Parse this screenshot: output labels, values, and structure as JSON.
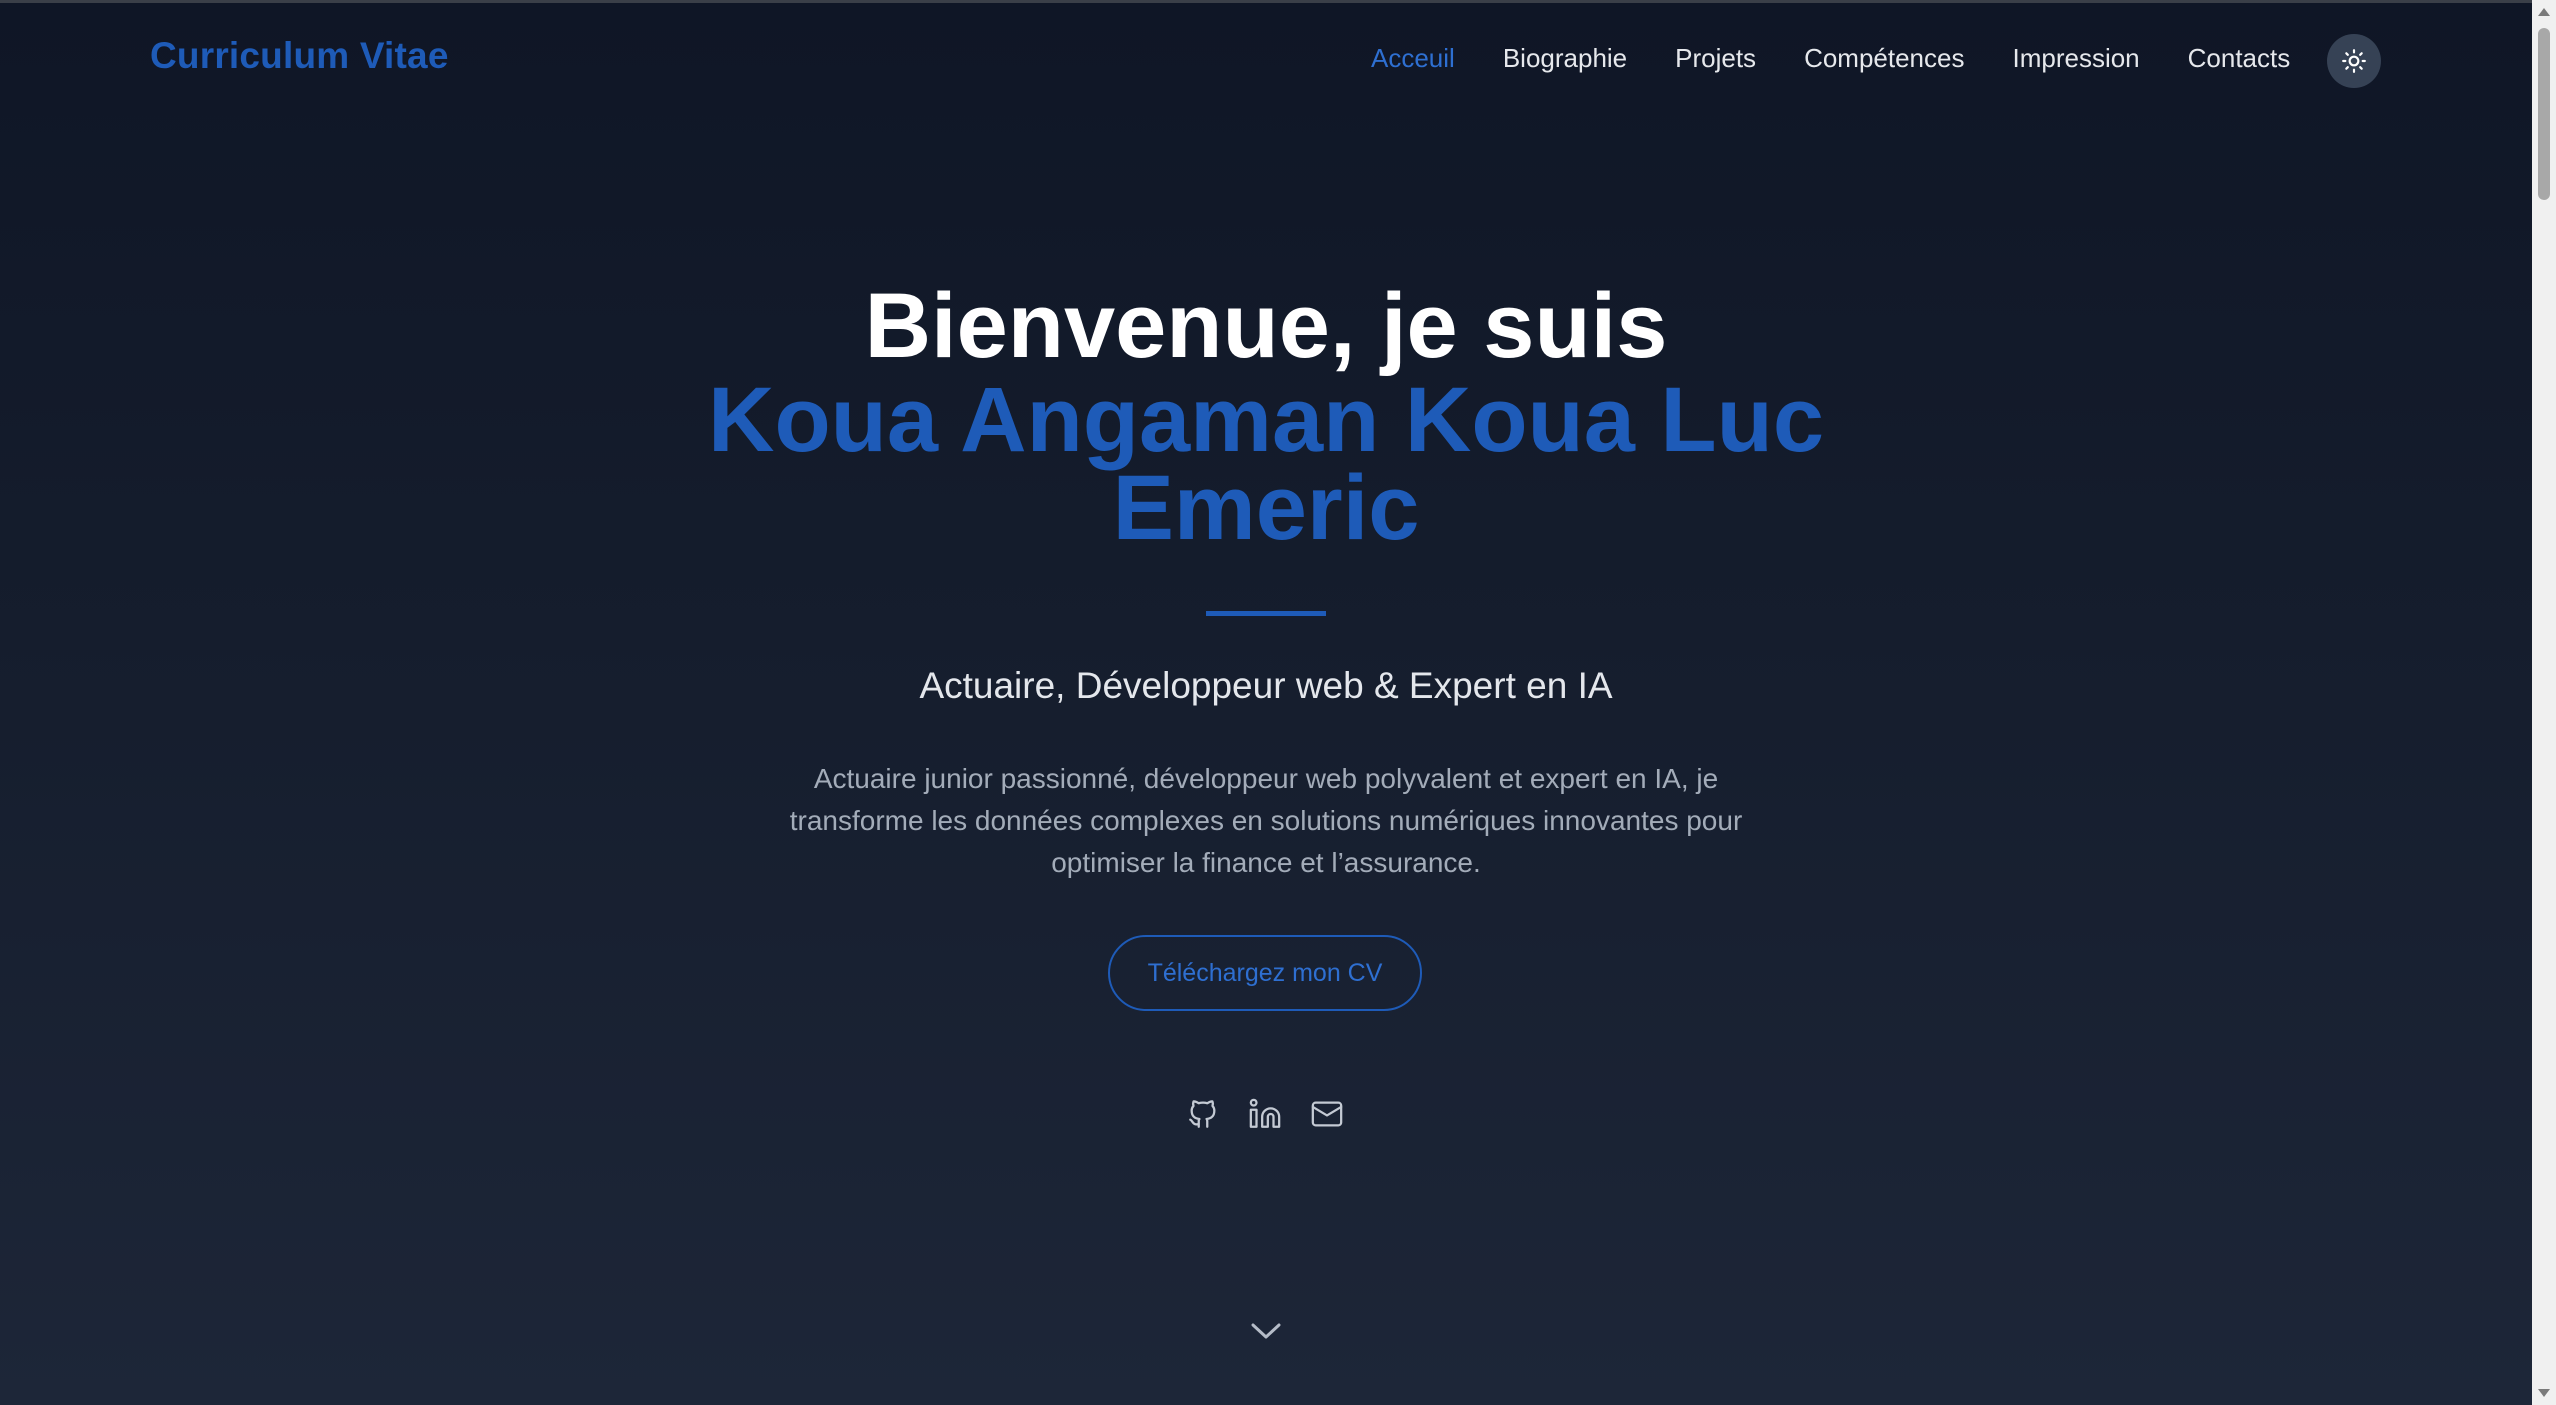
{
  "nav": {
    "logo": "Curriculum Vitae",
    "links": [
      {
        "label": "Acceuil",
        "active": true
      },
      {
        "label": "Biographie",
        "active": false
      },
      {
        "label": "Projets",
        "active": false
      },
      {
        "label": "Compétences",
        "active": false
      },
      {
        "label": "Impression",
        "active": false
      },
      {
        "label": "Contacts",
        "active": false
      }
    ],
    "theme_toggle_icon": "sun-icon"
  },
  "hero": {
    "greeting": "Bienvenue, je suis",
    "name_line1": "Koua Angaman Koua Luc",
    "name_line2": "Emeric",
    "subtitle": "Actuaire, Développeur web & Expert en IA",
    "description": "Actuaire junior passionné, développeur web polyvalent et expert en IA, je transforme les données complexes en solutions numériques innovantes pour optimiser la finance et l’assurance.",
    "cta_label": "Téléchargez mon CV",
    "socials": [
      "github-icon",
      "linkedin-icon",
      "mail-icon"
    ],
    "scroll_icon": "chevron-down-icon"
  },
  "colors": {
    "accent": "#1e5bb8",
    "background": "#151d2d",
    "text": "#ffffff",
    "muted": "#a3acb9"
  }
}
